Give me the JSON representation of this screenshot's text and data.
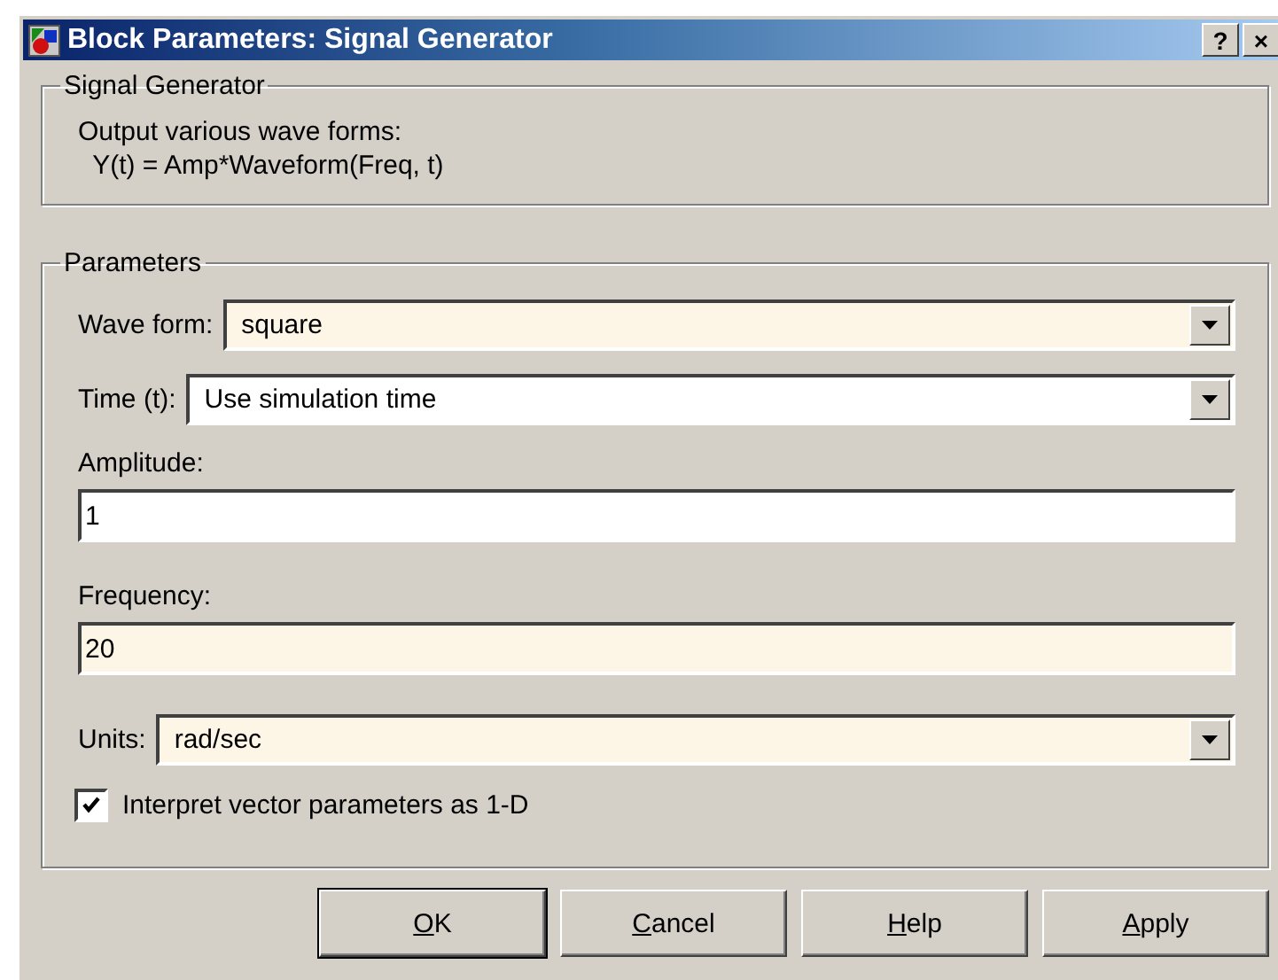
{
  "window": {
    "title": "Block Parameters: Signal Generator",
    "title_buttons": [
      "?",
      "×"
    ]
  },
  "description_group": {
    "title": "Signal Generator",
    "lines": [
      "Output various wave forms:",
      "  Y(t) = Amp*Waveform(Freq, t)"
    ]
  },
  "parameters_group": {
    "title": "Parameters",
    "controls": [
      {
        "kind": "dropdown",
        "label": "Wave form:",
        "value": "square",
        "highlighted": true
      },
      {
        "kind": "dropdown",
        "label": "Time (t):",
        "value": "Use simulation time",
        "highlighted": false
      },
      {
        "kind": "text",
        "label": "Amplitude:",
        "value": "1",
        "highlighted": false
      },
      {
        "kind": "text",
        "label": "Frequency:",
        "value": "20",
        "highlighted": true
      },
      {
        "kind": "dropdown",
        "label": "Units:",
        "value": "rad/sec",
        "highlighted": true
      },
      {
        "kind": "checkbox",
        "label": "Interpret vector parameters as 1-D",
        "checked": true
      }
    ]
  },
  "buttons": [
    "OK",
    "Cancel",
    "Help",
    "Apply"
  ]
}
